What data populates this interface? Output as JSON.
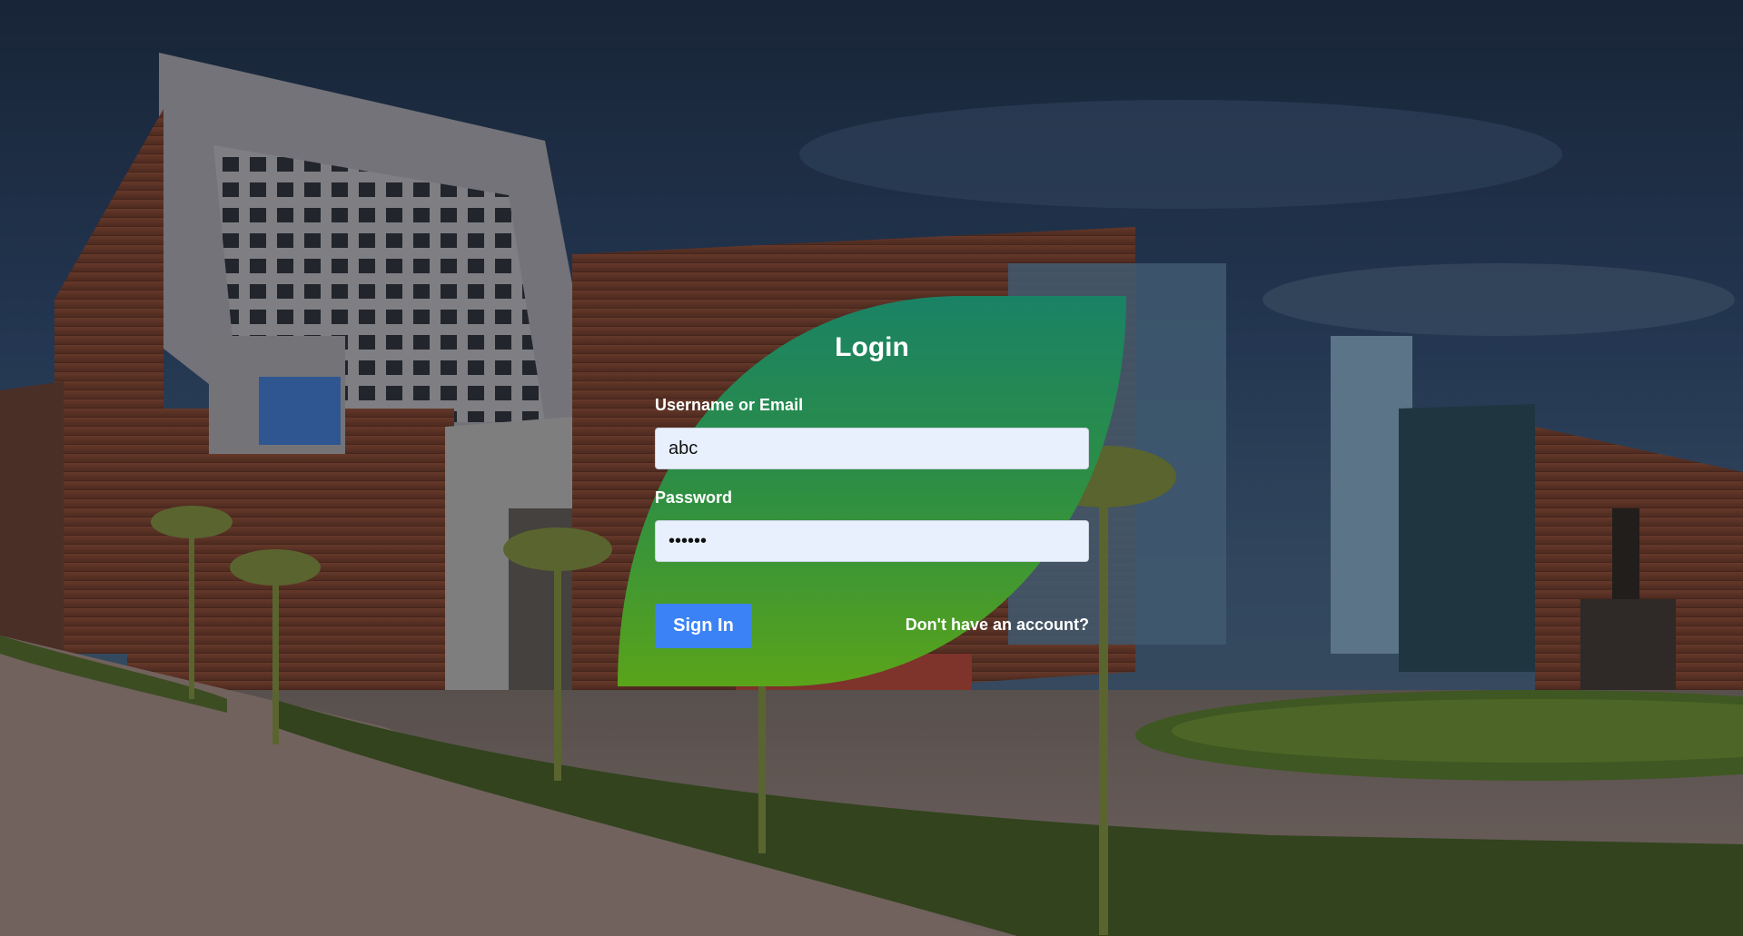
{
  "page": {
    "colors": {
      "leaf_top": "#1a8265",
      "leaf_bottom": "#5aa41a",
      "button": "#3b82f6",
      "input_bg": "#e8f0fe"
    }
  },
  "background": {
    "description_icon": "campus-building-photo"
  },
  "login": {
    "title": "Login",
    "username_label": "Username or Email",
    "username_value": "abc",
    "password_label": "Password",
    "password_value": "••••••",
    "signin_label": "Sign In",
    "signup_link": "Don't have an account?"
  }
}
